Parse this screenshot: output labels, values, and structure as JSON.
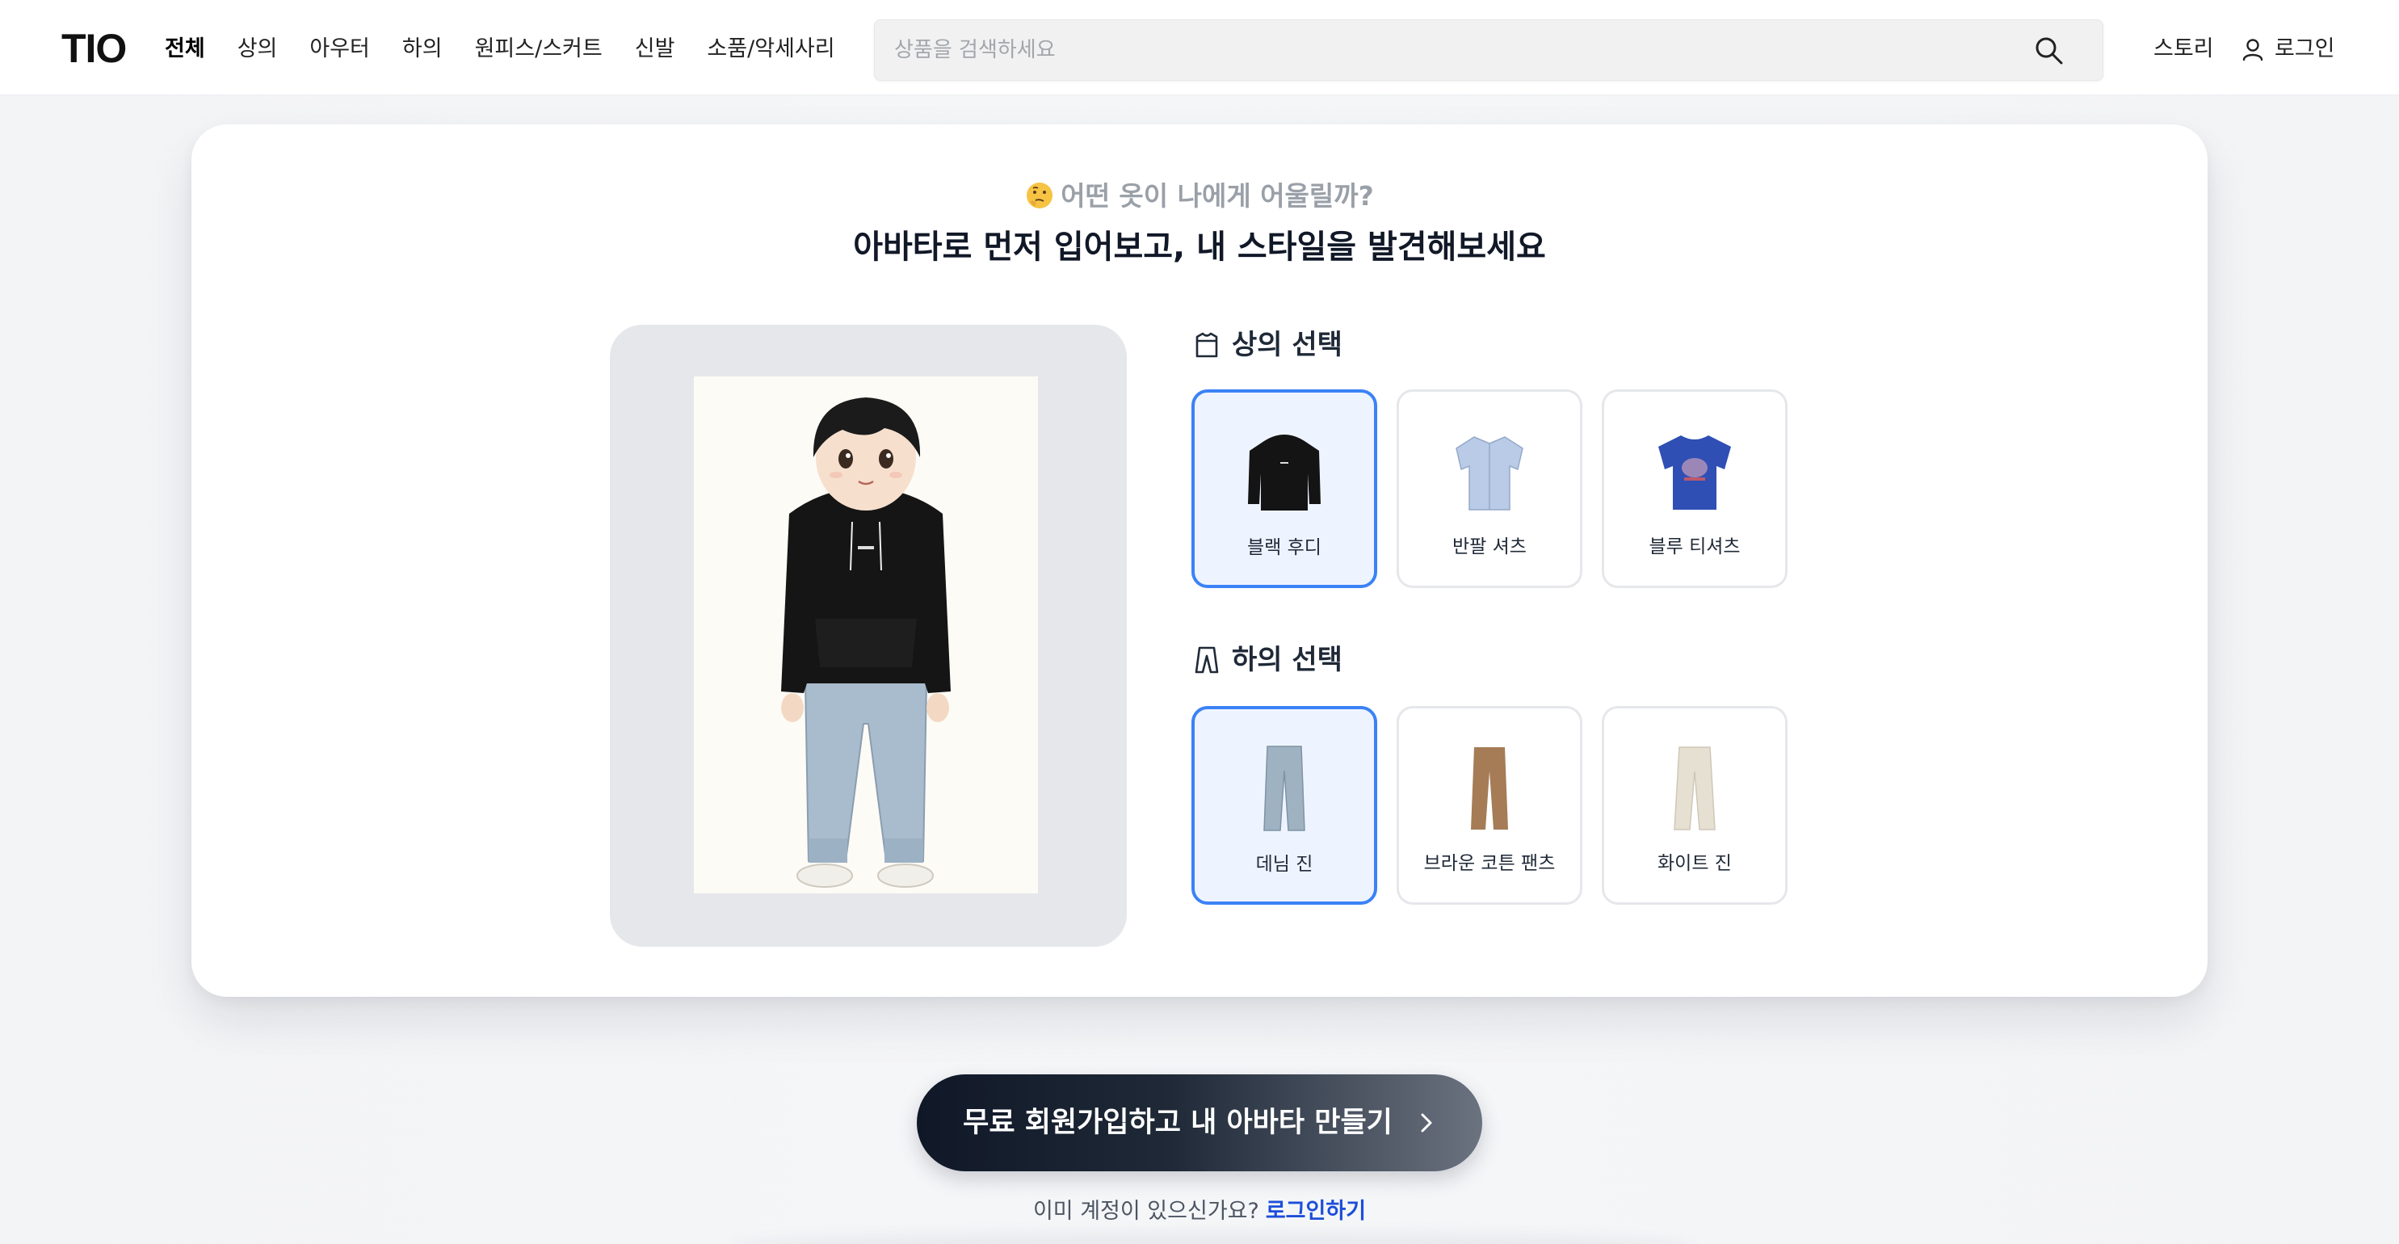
{
  "header": {
    "logo": "TIO",
    "nav": [
      "전체",
      "상의",
      "아우터",
      "하의",
      "원피스/스커트",
      "신발",
      "소품/악세사리"
    ],
    "active_nav": "전체",
    "search_placeholder": "상품을 검색하세요",
    "story_label": "스토리",
    "login_label": "로그인"
  },
  "hero": {
    "subtitle": "어떤 옷이 나에게 어울릴까?",
    "title": "아바타로 먼저 입어보고, 내 스타일을 발견해보세요"
  },
  "tops": {
    "section_title": "상의 선택",
    "selected": "블랙 후디",
    "options": [
      {
        "label": "블랙 후디",
        "color": "#141414"
      },
      {
        "label": "반팔 셔츠",
        "color": "#b9cbe6"
      },
      {
        "label": "블루 티셔츠",
        "color": "#2f4fb5"
      }
    ]
  },
  "bottoms": {
    "section_title": "하의 선택",
    "selected": "데님 진",
    "options": [
      {
        "label": "데님 진",
        "color": "#9fb2c2"
      },
      {
        "label": "브라운 코튼 팬츠",
        "color": "#a57c56"
      },
      {
        "label": "화이트 진",
        "color": "#e6e0d2"
      }
    ]
  },
  "cta": {
    "label": "무료 회원가입하고 내 아바타 만들기"
  },
  "footer": {
    "question": "이미 계정이 있으신가요?",
    "login_link": "로그인하기"
  },
  "colors": {
    "accent": "#3b82f6",
    "link": "#1d4ed8",
    "selected_bg": "#eef4ff"
  }
}
